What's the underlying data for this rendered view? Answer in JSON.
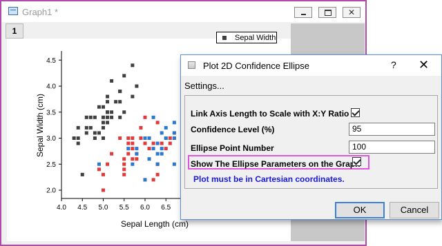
{
  "graph_window": {
    "title": "Graph1 *",
    "layer_tab": "1",
    "legend_label": "Sepal Width",
    "close_glyph": "✕"
  },
  "chart_data": {
    "type": "scatter",
    "xlabel": "Sepal Length (cm)",
    "ylabel": "Sepal Width (cm)",
    "xlim": [
      4.0,
      6.9
    ],
    "ylim": [
      1.85,
      4.6
    ],
    "xticks": [
      "4.0",
      "4.5",
      "5.0",
      "5.5",
      "6.0",
      "6.5"
    ],
    "yticks": [
      "2.0",
      "2.5",
      "3.0",
      "3.5",
      "4.0",
      "4.5"
    ],
    "series": [
      {
        "name": "Sepal Width",
        "color": "#404040",
        "x": [
          4.3,
          4.4,
          4.4,
          4.4,
          4.5,
          4.6,
          4.6,
          4.6,
          4.7,
          4.7,
          4.8,
          4.8,
          4.8,
          4.9,
          4.9,
          5.0,
          5.0,
          5.0,
          5.0,
          5.0,
          5.1,
          5.1,
          5.1,
          5.1,
          5.1,
          5.1,
          5.2,
          5.2,
          5.2,
          5.3,
          5.4,
          5.4,
          5.4,
          5.4,
          5.5,
          5.5,
          5.7,
          5.7,
          5.8
        ],
        "y": [
          3.0,
          2.9,
          3.0,
          3.2,
          2.3,
          3.1,
          3.2,
          3.4,
          3.2,
          3.4,
          3.0,
          3.1,
          3.4,
          3.1,
          3.6,
          3.0,
          3.2,
          3.3,
          3.4,
          3.6,
          3.3,
          3.4,
          3.5,
          3.7,
          3.8,
          3.5,
          3.4,
          3.5,
          4.1,
          3.7,
          3.4,
          3.7,
          3.9,
          3.9,
          3.5,
          4.2,
          3.8,
          4.4,
          4.0
        ]
      },
      {
        "name": "",
        "color": "#e03a3a",
        "x": [
          4.9,
          5.0,
          5.0,
          5.1,
          5.2,
          5.4,
          5.5,
          5.5,
          5.5,
          5.5,
          5.6,
          5.6,
          5.6,
          5.7,
          5.7,
          5.7,
          5.7,
          5.8,
          5.8,
          5.9,
          5.9,
          6.0,
          6.0,
          6.0,
          6.1,
          6.1,
          6.2,
          6.2,
          6.3,
          6.3,
          6.3,
          6.4,
          6.5,
          6.6,
          6.6,
          6.7,
          6.7
        ],
        "y": [
          2.4,
          2.0,
          2.3,
          2.5,
          2.7,
          3.0,
          2.3,
          2.4,
          2.5,
          2.6,
          2.7,
          2.9,
          3.0,
          2.6,
          2.8,
          2.9,
          3.0,
          2.6,
          2.7,
          3.0,
          3.2,
          2.2,
          2.9,
          3.4,
          2.8,
          3.0,
          2.2,
          2.9,
          2.3,
          2.5,
          3.3,
          2.9,
          2.8,
          2.9,
          3.0,
          3.1,
          3.0
        ]
      },
      {
        "name": "",
        "color": "#2a78d0",
        "x": [
          4.9,
          5.6,
          5.7,
          5.8,
          5.8,
          6.0,
          6.0,
          6.1,
          6.1,
          6.2,
          6.2,
          6.3,
          6.3,
          6.3,
          6.4,
          6.4,
          6.4,
          6.5,
          6.5,
          6.5,
          6.7,
          6.7,
          6.7,
          6.7
        ],
        "y": [
          2.5,
          2.8,
          2.5,
          2.7,
          2.8,
          2.2,
          3.0,
          2.6,
          3.0,
          2.8,
          3.4,
          2.5,
          2.7,
          2.9,
          2.7,
          2.8,
          3.1,
          3.0,
          3.0,
          3.2,
          2.5,
          3.0,
          3.1,
          3.3
        ]
      }
    ]
  },
  "dialog": {
    "title": "Plot 2D Confidence Ellipse",
    "help": "?",
    "close_glyph": "✕",
    "settings_label": "Settings...",
    "link_axis_label": "Link Axis Length to Scale with X:Y Ratio",
    "link_axis_checked": true,
    "confidence_label": "Confidence Level (%)",
    "confidence_value": "95",
    "ellipse_points_label": "Ellipse Point Number",
    "ellipse_points_value": "100",
    "show_params_label": "Show The Ellipse Parameters on the Graph",
    "show_params_checked": true,
    "note": "Plot must be in Cartesian coordinates.",
    "note_color": "#1a1ad6",
    "ok_label": "OK",
    "cancel_label": "Cancel"
  }
}
